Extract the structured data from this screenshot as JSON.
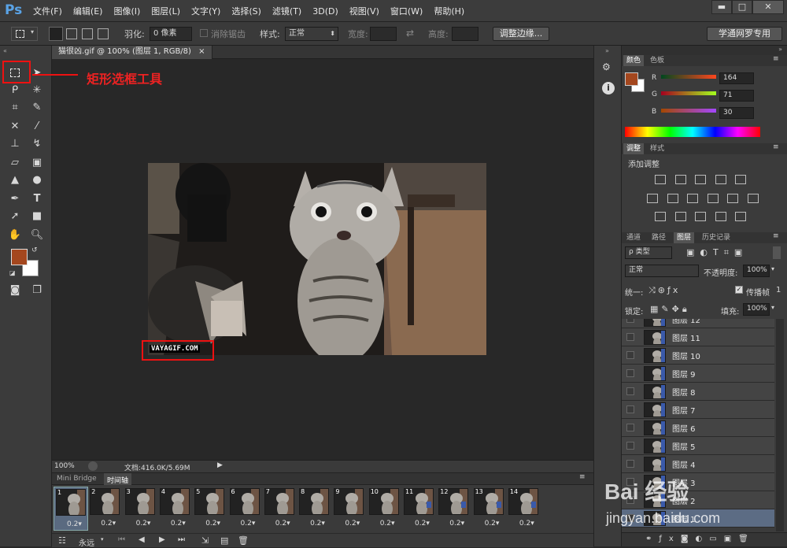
{
  "app": {
    "logo": "Ps",
    "menus": [
      "文件(F)",
      "编辑(E)",
      "图像(I)",
      "图层(L)",
      "文字(Y)",
      "选择(S)",
      "滤镜(T)",
      "3D(D)",
      "视图(V)",
      "窗口(W)",
      "帮助(H)"
    ],
    "window_buttons": [
      "▬",
      "□",
      "✕"
    ]
  },
  "options": {
    "feather_label": "羽化:",
    "feather_value": "0 像素",
    "antialias_label": "消除锯齿",
    "style_label": "样式:",
    "style_value": "正常",
    "width_label": "宽度:",
    "height_label": "高度:",
    "refine_edge_button": "调整边缘...",
    "workspace_button": "学通网罗专用"
  },
  "document": {
    "tab_title": "猫很凶.gif @ 100% (图层 1, RGB/8)",
    "close": "×",
    "watermark": "VAYAGIF.COM",
    "zoom": "100%",
    "doc_size": "文档:416.0K/5.69M"
  },
  "annotation": {
    "label": "矩形选框工具"
  },
  "timeline": {
    "tabs": [
      "Mini Bridge",
      "时间轴"
    ],
    "frames": [
      {
        "num": "1",
        "delay": "0.2▾"
      },
      {
        "num": "2",
        "delay": "0.2▾"
      },
      {
        "num": "3",
        "delay": "0.2▾"
      },
      {
        "num": "4",
        "delay": "0.2▾"
      },
      {
        "num": "5",
        "delay": "0.2▾"
      },
      {
        "num": "6",
        "delay": "0.2▾"
      },
      {
        "num": "7",
        "delay": "0.2▾"
      },
      {
        "num": "8",
        "delay": "0.2▾"
      },
      {
        "num": "9",
        "delay": "0.2▾"
      },
      {
        "num": "10",
        "delay": "0.2▾"
      },
      {
        "num": "11",
        "delay": "0.2▾"
      },
      {
        "num": "12",
        "delay": "0.2▾"
      },
      {
        "num": "13",
        "delay": "0.2▾"
      },
      {
        "num": "14",
        "delay": "0.2▾"
      }
    ],
    "loop": "永远",
    "controls": [
      "⏮",
      "◀",
      "▶",
      "⏭"
    ]
  },
  "color_panel": {
    "tabs": [
      "颜色",
      "色板"
    ],
    "r_label": "R",
    "r_value": "164",
    "g_label": "G",
    "g_value": "71",
    "b_label": "B",
    "b_value": "30",
    "foreground": "#a4471e"
  },
  "adjust_panel": {
    "tabs": [
      "调整",
      "样式"
    ],
    "title": "添加调整"
  },
  "layers_panel": {
    "tabs": [
      "通道",
      "路径",
      "图层",
      "历史记录"
    ],
    "kind_label": "ρ 类型",
    "blend": "正常",
    "opacity_label": "不透明度:",
    "opacity_value": "100%",
    "unify_label": "统一:",
    "propagate_label": "传播帧",
    "propagate_value": "1",
    "lock_label": "锁定:",
    "fill_label": "填充:",
    "fill_value": "100%",
    "layers": [
      "图层 12",
      "图层 11",
      "图层 10",
      "图层 9",
      "图层 8",
      "图层 7",
      "图层 6",
      "图层 5",
      "图层 4",
      "图层 3",
      "图层 2",
      "图层 1"
    ]
  },
  "watermark_baidu": {
    "text": "Bai 经验",
    "url": "jingyan.baidu.com"
  }
}
